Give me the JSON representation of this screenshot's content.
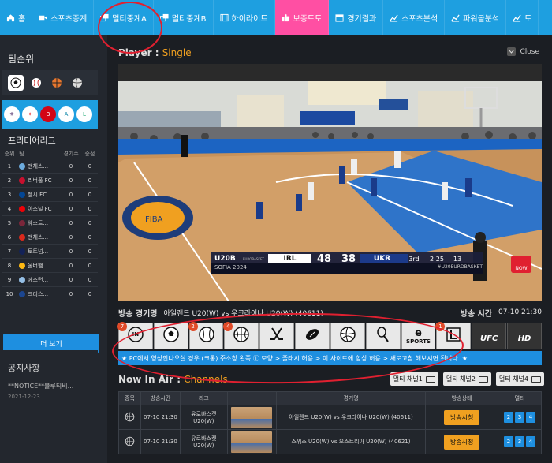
{
  "nav": {
    "items": [
      {
        "label": "홈",
        "icon": "home-icon"
      },
      {
        "label": "스포츠중계",
        "icon": "video-icon"
      },
      {
        "label": "멀티중계A",
        "icon": "multi-window-icon"
      },
      {
        "label": "멀티중계B",
        "icon": "multi-window-icon"
      },
      {
        "label": "하이라이트",
        "icon": "film-icon"
      },
      {
        "label": "보증토토",
        "icon": "thumbs-up-icon",
        "highlight": true
      },
      {
        "label": "경기결과",
        "icon": "calendar-icon"
      },
      {
        "label": "스포츠분석",
        "icon": "chart-icon"
      },
      {
        "label": "파워볼분석",
        "icon": "chart-icon"
      },
      {
        "label": "토",
        "icon": "chart-icon"
      }
    ]
  },
  "sidebar": {
    "title": "팀순위",
    "league": "프리미어리그",
    "columns": [
      "순위",
      "팀",
      "경기수",
      "승점"
    ],
    "rows": [
      {
        "rank": "1",
        "team": "맨체스...",
        "games": "0",
        "pts": "0",
        "color": "#6cabdd"
      },
      {
        "rank": "2",
        "team": "리버풀 FC",
        "games": "0",
        "pts": "0",
        "color": "#c8102e"
      },
      {
        "rank": "3",
        "team": "첼시 FC",
        "games": "0",
        "pts": "0",
        "color": "#034694"
      },
      {
        "rank": "4",
        "team": "아스널 FC",
        "games": "0",
        "pts": "0",
        "color": "#ef0107"
      },
      {
        "rank": "5",
        "team": "웨스트...",
        "games": "0",
        "pts": "0",
        "color": "#7a263a"
      },
      {
        "rank": "6",
        "team": "맨체스...",
        "games": "0",
        "pts": "0",
        "color": "#da291c"
      },
      {
        "rank": "7",
        "team": "토트넘...",
        "games": "0",
        "pts": "0",
        "color": "#132257"
      },
      {
        "rank": "8",
        "team": "울버햄...",
        "games": "0",
        "pts": "0",
        "color": "#fdb913"
      },
      {
        "rank": "9",
        "team": "에스턴...",
        "games": "0",
        "pts": "0",
        "color": "#95bfe5"
      },
      {
        "rank": "10",
        "team": "크리스...",
        "games": "0",
        "pts": "0",
        "color": "#1b458f"
      }
    ],
    "more_label": "더 보기",
    "notice_title": "공지사항",
    "notice_item": "**NOTICE**블루티비...",
    "notice_date": "2021-12-23"
  },
  "player": {
    "label": "Player :",
    "mode": "Single",
    "close_label": "Close",
    "scoreboard": {
      "event": "U20B",
      "event_sub": "EUROBASKET",
      "place": "SOFIA 2024",
      "home": "IRL",
      "home_score": "48",
      "away_score": "38",
      "away": "UKR",
      "period": "3rd",
      "clock": "2:25",
      "shot_clock": "13",
      "hashtag": "#U20EURDBASKET",
      "live_badge": "NOW"
    }
  },
  "broadcast": {
    "label_left": "방송 경기명",
    "match": "아일랜드 U20(W) vs 우크라이나 U20(W) (40611)",
    "label_right": "방송 시간",
    "time": "07-10 21:30"
  },
  "sports": [
    {
      "icon": "in-play-icon",
      "count": "7",
      "text": "IN"
    },
    {
      "icon": "soccer-icon",
      "count": ""
    },
    {
      "icon": "baseball-icon",
      "count": "2"
    },
    {
      "icon": "basketball-icon",
      "count": "4"
    },
    {
      "icon": "hockey-icon",
      "count": ""
    },
    {
      "icon": "football-icon",
      "count": ""
    },
    {
      "icon": "volleyball-icon",
      "count": ""
    },
    {
      "icon": "tennis-icon",
      "count": ""
    },
    {
      "icon": "esports-icon",
      "count": "",
      "text": "SPORTS"
    },
    {
      "icon": "lol-icon",
      "count": "1"
    },
    {
      "icon": "ufc-icon",
      "count": "",
      "text": "UFC"
    },
    {
      "icon": "hd-icon",
      "count": "",
      "text": "HD"
    }
  ],
  "marquee": "★ PC에서 영상안나오실 경우 (크롬) 주소창 왼쪽 ⓘ 모양 > 플래시 허용 > 이 사이트에 항상 허용 > 새로고침 해보시면 됩니다. ★",
  "now_in_air": {
    "label": "Now In Air :",
    "channels": "Channels",
    "tabs": [
      "멀티 채널1",
      "멀티 채널2",
      "멀티 채널4"
    ],
    "columns": [
      "종목",
      "방송시간",
      "리그",
      "",
      "경기명",
      "방송상태",
      "멀티"
    ],
    "rows": [
      {
        "time": "07-10 21:30",
        "league": "유로바스켓 U20(W)",
        "match": "아일랜드 U20(W) vs 우크라이나 U20(W) (40611)",
        "status": "방송시청",
        "multi": [
          "2",
          "3",
          "4"
        ]
      },
      {
        "time": "07-10 21:30",
        "league": "유로바스켓 U20(W)",
        "match": "스위스 U20(W) vs 오스트리아 U20(W) (40621)",
        "status": "방송시청",
        "multi": [
          "2",
          "3",
          "4"
        ]
      }
    ]
  }
}
